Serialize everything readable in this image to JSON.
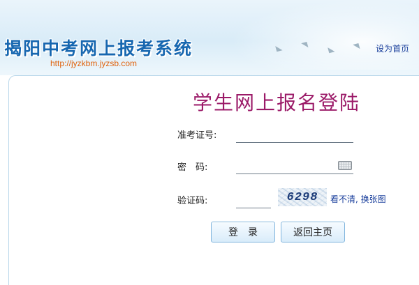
{
  "header": {
    "title": "揭阳中考网上报考系统",
    "url": "http://jyzkbm.jyzsb.com",
    "set_home": "设为首页"
  },
  "login": {
    "title": "学生网上报名登陆",
    "exam_no_label": "准考证号:",
    "password_label": "密　码:",
    "captcha_label": "验证码:",
    "exam_no_value": "",
    "password_value": "",
    "captcha_value": "",
    "captcha_code": "6298",
    "refresh_captcha": "看不清, 换张图",
    "login_button": "登　录",
    "back_button": "返回主页"
  },
  "icons": [
    "bird-icon",
    "keyboard-icon",
    "captcha-image"
  ]
}
